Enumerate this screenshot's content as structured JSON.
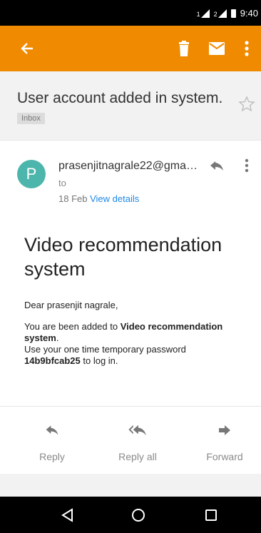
{
  "status_bar": {
    "sim1_label": "1",
    "sim2_label": "2",
    "time": "9:40"
  },
  "app_bar": {
    "color": "#f08a00",
    "back_icon": "arrow-left-icon",
    "delete_icon": "trash-icon",
    "mark_icon": "mail-icon",
    "more_icon": "more-vert-icon"
  },
  "email": {
    "subject": "User account added in system.",
    "label": "Inbox",
    "avatar_letter": "P",
    "sender": "prasenjitnagrale22@gma…",
    "to_label": "to",
    "date": "18 Feb",
    "view_details": "View details",
    "body": {
      "title": "Video recommendation system",
      "greeting": "Dear prasenjit nagrale,",
      "line1_a": "You are been added to ",
      "line1_bold": "Video recommendation system",
      "line1_end": ".",
      "line2": "Use your one time temporary password",
      "password": "14b9bfcab25",
      "line3_end": " to log in."
    }
  },
  "actions": {
    "reply": "Reply",
    "reply_all": "Reply all",
    "forward": "Forward"
  },
  "nav_bar": {
    "back": "back-triangle-icon",
    "home": "home-circle-icon",
    "recents": "recents-square-icon"
  }
}
